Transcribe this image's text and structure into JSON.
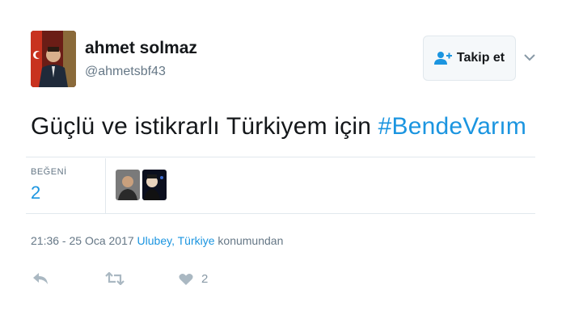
{
  "user": {
    "display_name": "ahmet solmaz",
    "handle": "@ahmetsbf43"
  },
  "follow_button": {
    "label": "Takip et",
    "icon": "add-user-icon"
  },
  "tweet": {
    "text": "Güçlü ve istikrarlı Türkiyem için ",
    "hashtag": "#BendeVarım"
  },
  "stats": {
    "likes_label": "BEĞENİ",
    "likes_count": "2"
  },
  "meta": {
    "timestamp": "21:36 - 25 Oca 2017",
    "location": "Ulubey, Türkiye",
    "location_suffix": "konumundan"
  },
  "actions": {
    "reply_icon": "reply-icon",
    "retweet_icon": "retweet-icon",
    "like_icon": "heart-icon",
    "like_count": "2"
  },
  "colors": {
    "link": "#1b95e0",
    "muted": "#657786",
    "text": "#14171a",
    "divider": "#e1e8ed"
  }
}
